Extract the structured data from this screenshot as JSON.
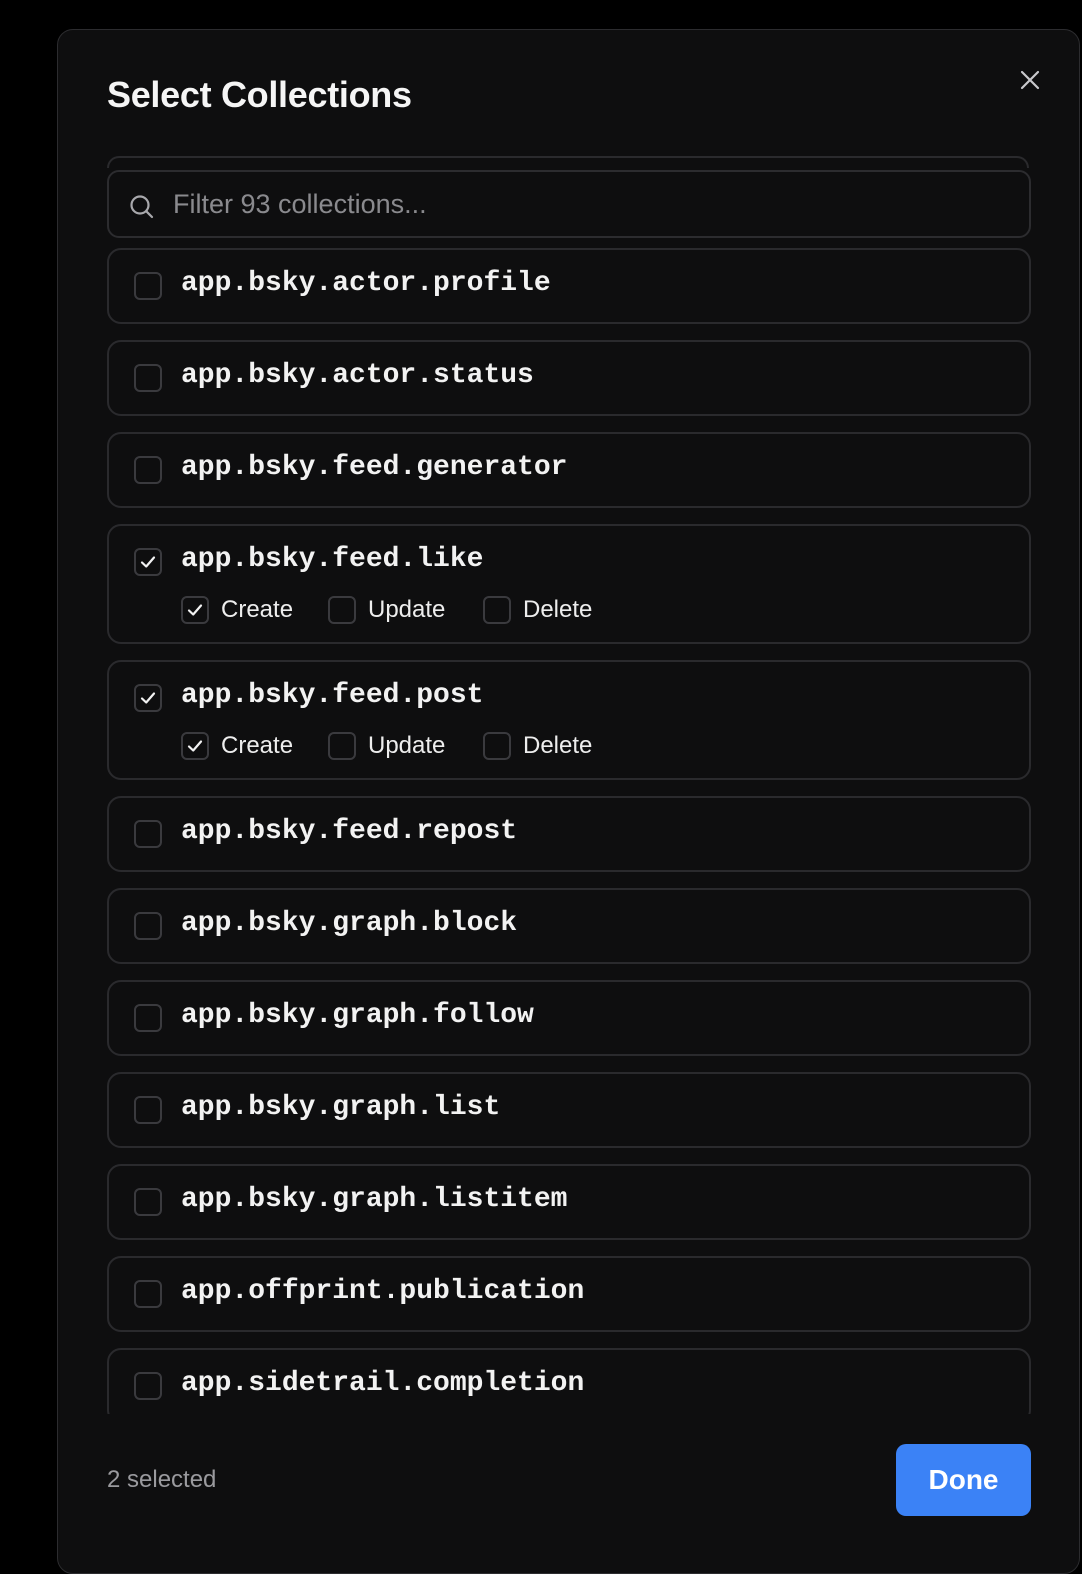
{
  "dialog": {
    "title": "Select Collections",
    "close_icon": "close-icon"
  },
  "search": {
    "placeholder": "Filter 93 collections...",
    "value": "",
    "icon": "search-icon"
  },
  "collections": [
    {
      "label": "app.bsky.actor.profile",
      "checked": false
    },
    {
      "label": "app.bsky.actor.status",
      "checked": false
    },
    {
      "label": "app.bsky.feed.generator",
      "checked": false
    },
    {
      "label": "app.bsky.feed.like",
      "checked": true,
      "permissions": [
        {
          "label": "Create",
          "checked": true
        },
        {
          "label": "Update",
          "checked": false
        },
        {
          "label": "Delete",
          "checked": false
        }
      ]
    },
    {
      "label": "app.bsky.feed.post",
      "checked": true,
      "permissions": [
        {
          "label": "Create",
          "checked": true
        },
        {
          "label": "Update",
          "checked": false
        },
        {
          "label": "Delete",
          "checked": false
        }
      ]
    },
    {
      "label": "app.bsky.feed.repost",
      "checked": false
    },
    {
      "label": "app.bsky.graph.block",
      "checked": false
    },
    {
      "label": "app.bsky.graph.follow",
      "checked": false
    },
    {
      "label": "app.bsky.graph.list",
      "checked": false
    },
    {
      "label": "app.bsky.graph.listitem",
      "checked": false
    },
    {
      "label": "app.offprint.publication",
      "checked": false
    },
    {
      "label": "app.sidetrail.completion",
      "checked": false
    }
  ],
  "footer": {
    "status": "2 selected",
    "done_label": "Done"
  },
  "colors": {
    "background": "#0e0e0f",
    "border": "#2a2a2d",
    "accent": "#3b82f6",
    "text": "#f2f2f2",
    "muted": "#9a9a9e"
  }
}
